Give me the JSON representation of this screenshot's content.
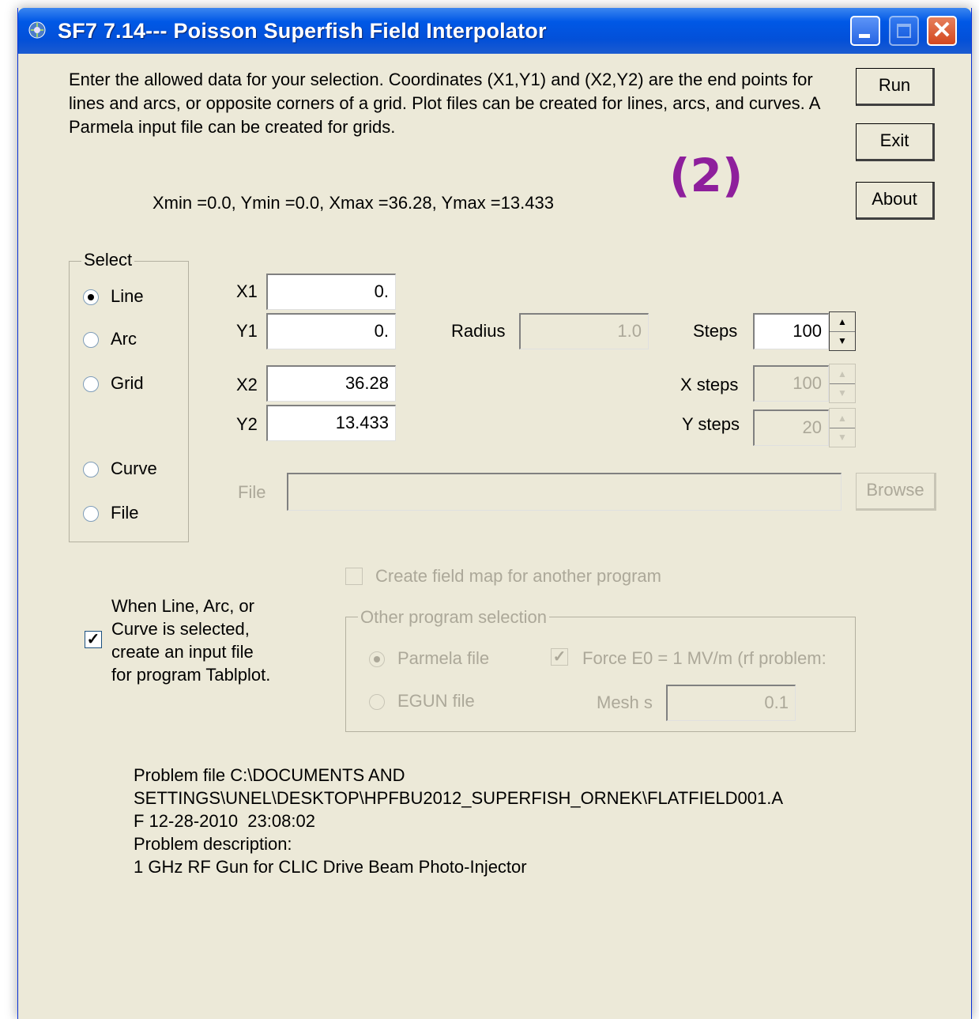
{
  "window": {
    "title": "SF7 7.14--- Poisson Superfish Field Interpolator",
    "minimize_label": "",
    "maximize_label": "",
    "close_label": "✕"
  },
  "intro_text": "Enter the allowed data for your selection.  Coordinates (X1,Y1) and (X2,Y2) are the end points for lines and arcs, or opposite corners of a grid.  Plot files can be created for lines, arcs, and curves.  A Parmela input file can be created for grids.",
  "annotation": "(2)",
  "bounds": "Xmin =0.0, Ymin =0.0, Xmax =36.28, Ymax =13.433",
  "buttons": {
    "run": "Run",
    "exit": "Exit",
    "about": "About",
    "browse": "Browse"
  },
  "select": {
    "label": "Select",
    "selected": "Line",
    "options": [
      "Line",
      "Arc",
      "Grid",
      "Curve",
      "File"
    ]
  },
  "coords": {
    "x1_label": "X1",
    "x1": "0.",
    "y1_label": "Y1",
    "y1": "0.",
    "x2_label": "X2",
    "x2": "36.28",
    "y2_label": "Y2",
    "y2": "13.433"
  },
  "radius": {
    "label": "Radius",
    "value": "1.0"
  },
  "steps": {
    "label": "Steps",
    "value": "100"
  },
  "x_steps": {
    "label": "X steps",
    "value": "100"
  },
  "y_steps": {
    "label": "Y steps",
    "value": "20"
  },
  "file": {
    "label": "File",
    "value": ""
  },
  "tablplot": {
    "checked": true,
    "text": "When Line, Arc, or\nCurve is selected,\ncreate an input file\nfor program Tablplot."
  },
  "field_map": {
    "label": "Create field map for another program",
    "checked": false
  },
  "other_program": {
    "label": "Other program selection",
    "parmela": "Parmela file",
    "egun": "EGUN file",
    "selected": "Parmela file",
    "force_e0": "Force E0 = 1 MV/m (rf problem:",
    "force_e0_checked": true,
    "mesh_label": "Mesh s",
    "mesh_value": "0.1"
  },
  "problem_info": "Problem file C:\\DOCUMENTS AND\nSETTINGS\\UNEL\\DESKTOP\\HPFBU2012_SUPERFISH_ORNEK\\FLATFIELD001.A\nF 12-28-2010  23:08:02\nProblem description:\n1 GHz RF Gun for CLIC Drive Beam Photo-Injector",
  "colors": {
    "titlebar": "#0058e6",
    "dialog_bg": "#ece9d8",
    "annotation": "#8e1f9c",
    "disabled_text": "#aca899"
  }
}
